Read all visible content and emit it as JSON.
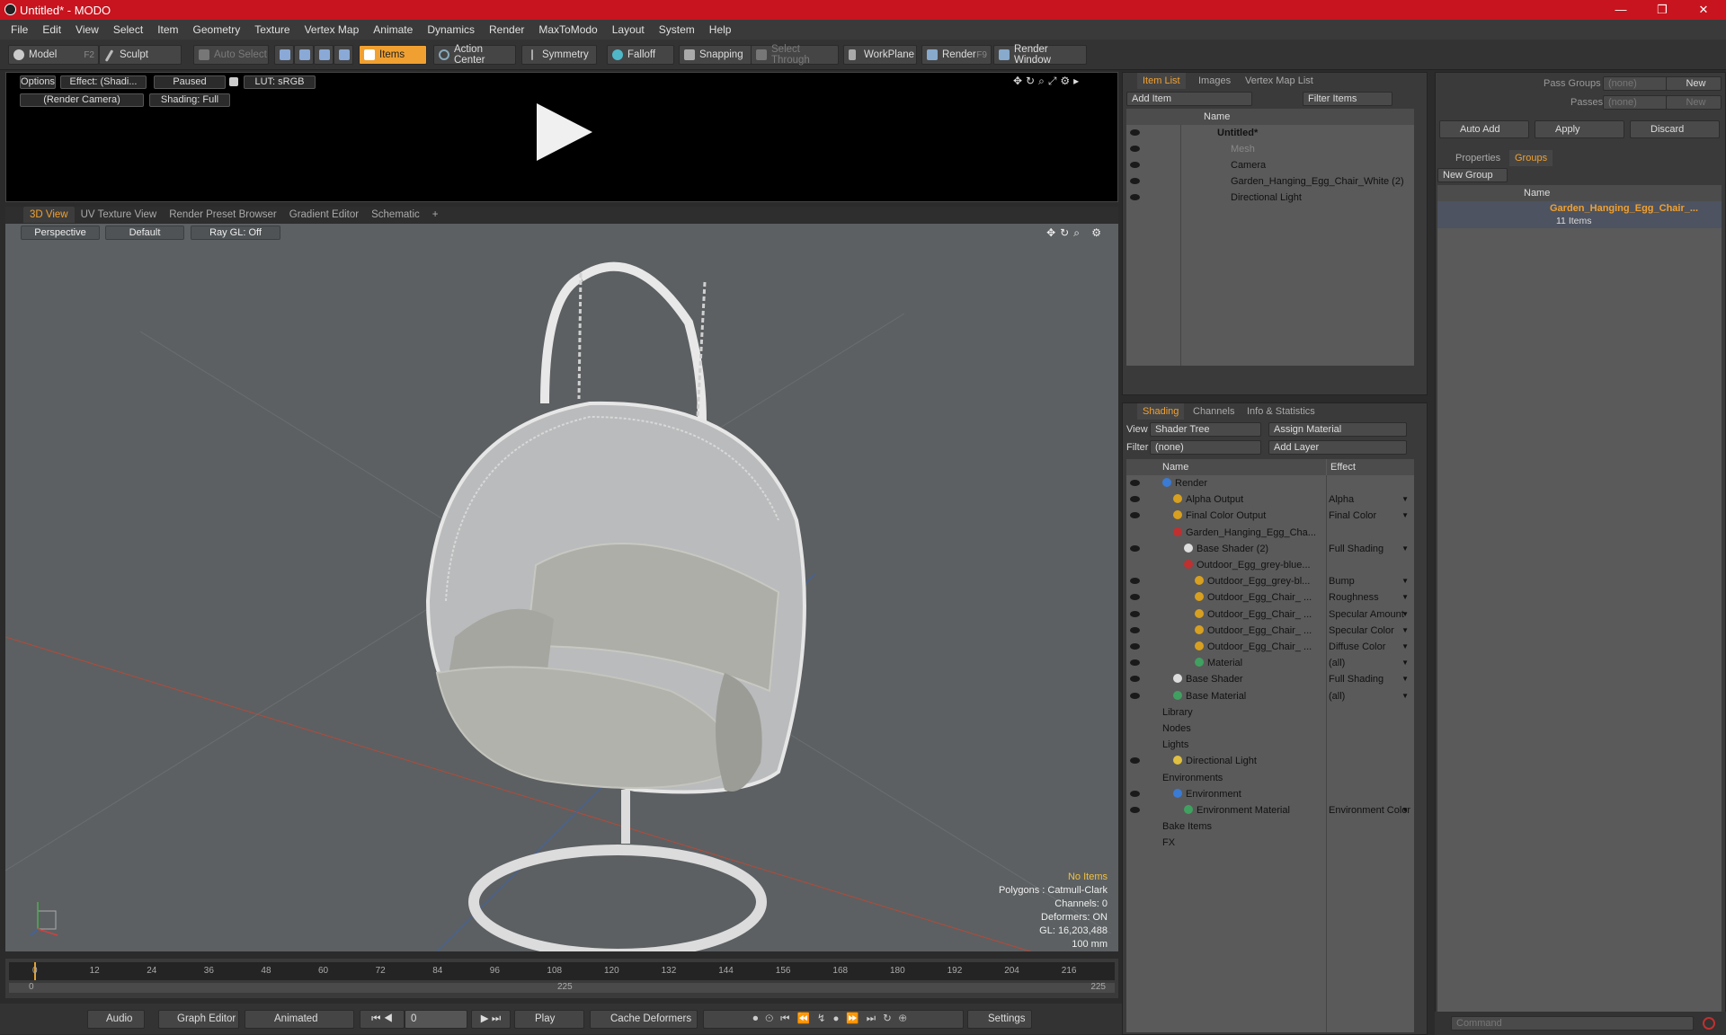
{
  "titlebar": {
    "title": "Untitled* - MODO",
    "min": "—",
    "max": "❐",
    "close": "✕"
  },
  "menu": [
    "File",
    "Edit",
    "View",
    "Select",
    "Item",
    "Geometry",
    "Texture",
    "Vertex Map",
    "Animate",
    "Dynamics",
    "Render",
    "MaxToModo",
    "Layout",
    "System",
    "Help"
  ],
  "toolbar": {
    "model": "Model",
    "model_key": "F2",
    "sculpt": "Sculpt",
    "auto_select": "Auto Select",
    "items": "Items",
    "action_center": "Action Center",
    "symmetry": "Symmetry",
    "falloff": "Falloff",
    "snapping": "Snapping",
    "select_through": "Select Through",
    "workplane": "WorkPlane",
    "render": "Render",
    "render_key": "F9",
    "render_window": "Render Window"
  },
  "render_preview": {
    "options": "Options",
    "effect": "Effect: (Shadi...",
    "paused": "Paused",
    "lut": "LUT: sRGB",
    "camera": "(Render Camera)",
    "shading": "Shading: Full"
  },
  "viewport_tabs": [
    "3D View",
    "UV Texture View",
    "Render Preset Browser",
    "Gradient Editor",
    "Schematic"
  ],
  "viewport": {
    "perspective": "Perspective",
    "default": "Default",
    "raygl": "Ray GL: Off",
    "info": {
      "items": "No Items",
      "polygons": "Polygons : Catmull-Clark",
      "channels": "Channels: 0",
      "deformers": "Deformers: ON",
      "gl": "GL: 16,203,488",
      "size": "100 mm"
    }
  },
  "timeline": {
    "ticks": [
      "0",
      "12",
      "24",
      "36",
      "48",
      "60",
      "72",
      "84",
      "96",
      "108",
      "120",
      "132",
      "144",
      "156",
      "168",
      "180",
      "192",
      "204",
      "216"
    ],
    "start": "0",
    "mid": "225",
    "end": "225"
  },
  "bottombar": {
    "audio": "Audio",
    "graph_editor": "Graph Editor",
    "animated": "Animated",
    "frame": "0",
    "play": "Play",
    "cache_deformers": "Cache Deformers",
    "settings": "Settings"
  },
  "item_list": {
    "tabs": [
      "Item List",
      "Images",
      "Vertex Map List"
    ],
    "add_item": "Add Item",
    "filter": "Filter Items",
    "col_name": "Name",
    "rows": [
      {
        "label": "Untitled*",
        "bold": true
      },
      {
        "label": "Mesh",
        "dim": true
      },
      {
        "label": "Camera"
      },
      {
        "label": "Garden_Hanging_Egg_Chair_White",
        "count": "(2)"
      },
      {
        "label": "Directional Light"
      }
    ]
  },
  "groups_panel": {
    "pass_groups": "Pass Groups",
    "passes": "Passes",
    "none": "(none)",
    "new": "New",
    "auto_add": "Auto Add",
    "apply": "Apply",
    "discard": "Discard",
    "tabs": [
      "Properties",
      "Groups"
    ],
    "new_group": "New Group",
    "col_name": "Name",
    "group_name": "Garden_Hanging_Egg_Chair_...",
    "group_count": "11 Items"
  },
  "shading": {
    "tabs": [
      "Shading",
      "Channels",
      "Info & Statistics"
    ],
    "view_label": "View",
    "view_value": "Shader Tree",
    "assign_material": "Assign Material",
    "filter_label": "Filter",
    "filter_value": "(none)",
    "add_layer": "Add Layer",
    "col_name": "Name",
    "col_effect": "Effect",
    "rows": [
      {
        "label": "Render",
        "effect": "",
        "indent": 0,
        "icon": "#3a7bd5"
      },
      {
        "label": "Alpha Output",
        "effect": "Alpha",
        "indent": 1,
        "icon": "#d8a020"
      },
      {
        "label": "Final Color Output",
        "effect": "Final Color",
        "indent": 1,
        "icon": "#d8a020"
      },
      {
        "label": "Garden_Hanging_Egg_Cha...",
        "effect": "",
        "indent": 1,
        "icon": "#c03030"
      },
      {
        "label": "Base Shader",
        "count": "(2)",
        "effect": "Full Shading",
        "indent": 2,
        "icon": "#dddddd"
      },
      {
        "label": "Outdoor_Egg_grey-blue...",
        "effect": "",
        "indent": 2,
        "icon": "#c03030"
      },
      {
        "label": "Outdoor_Egg_grey-bl...",
        "effect": "Bump",
        "indent": 3,
        "icon": "#d8a020"
      },
      {
        "label": "Outdoor_Egg_Chair_ ...",
        "effect": "Roughness",
        "indent": 3,
        "icon": "#d8a020"
      },
      {
        "label": "Outdoor_Egg_Chair_ ...",
        "effect": "Specular Amount",
        "indent": 3,
        "icon": "#d8a020"
      },
      {
        "label": "Outdoor_Egg_Chair_ ...",
        "effect": "Specular Color",
        "indent": 3,
        "icon": "#d8a020"
      },
      {
        "label": "Outdoor_Egg_Chair_ ...",
        "effect": "Diffuse Color",
        "indent": 3,
        "icon": "#d8a020"
      },
      {
        "label": "Material",
        "effect": "(all)",
        "indent": 3,
        "icon": "#40a060"
      },
      {
        "label": "Base Shader",
        "effect": "Full Shading",
        "indent": 1,
        "icon": "#dddddd"
      },
      {
        "label": "Base Material",
        "effect": "(all)",
        "indent": 1,
        "icon": "#40a060"
      },
      {
        "label": "Library",
        "effect": "",
        "indent": 0,
        "icon": ""
      },
      {
        "label": "Nodes",
        "effect": "",
        "indent": 0,
        "icon": ""
      },
      {
        "label": "Lights",
        "effect": "",
        "indent": 0,
        "icon": ""
      },
      {
        "label": "Directional Light",
        "effect": "",
        "indent": 1,
        "icon": "#e0c040"
      },
      {
        "label": "Environments",
        "effect": "",
        "indent": 0,
        "icon": ""
      },
      {
        "label": "Environment",
        "effect": "",
        "indent": 1,
        "icon": "#3a7bd5"
      },
      {
        "label": "Environment Material",
        "effect": "Environment Color",
        "indent": 2,
        "icon": "#40a060"
      },
      {
        "label": "Bake Items",
        "effect": "",
        "indent": 0,
        "icon": ""
      },
      {
        "label": "FX",
        "effect": "",
        "indent": 0,
        "icon": ""
      }
    ]
  },
  "command": {
    "placeholder": "Command"
  }
}
